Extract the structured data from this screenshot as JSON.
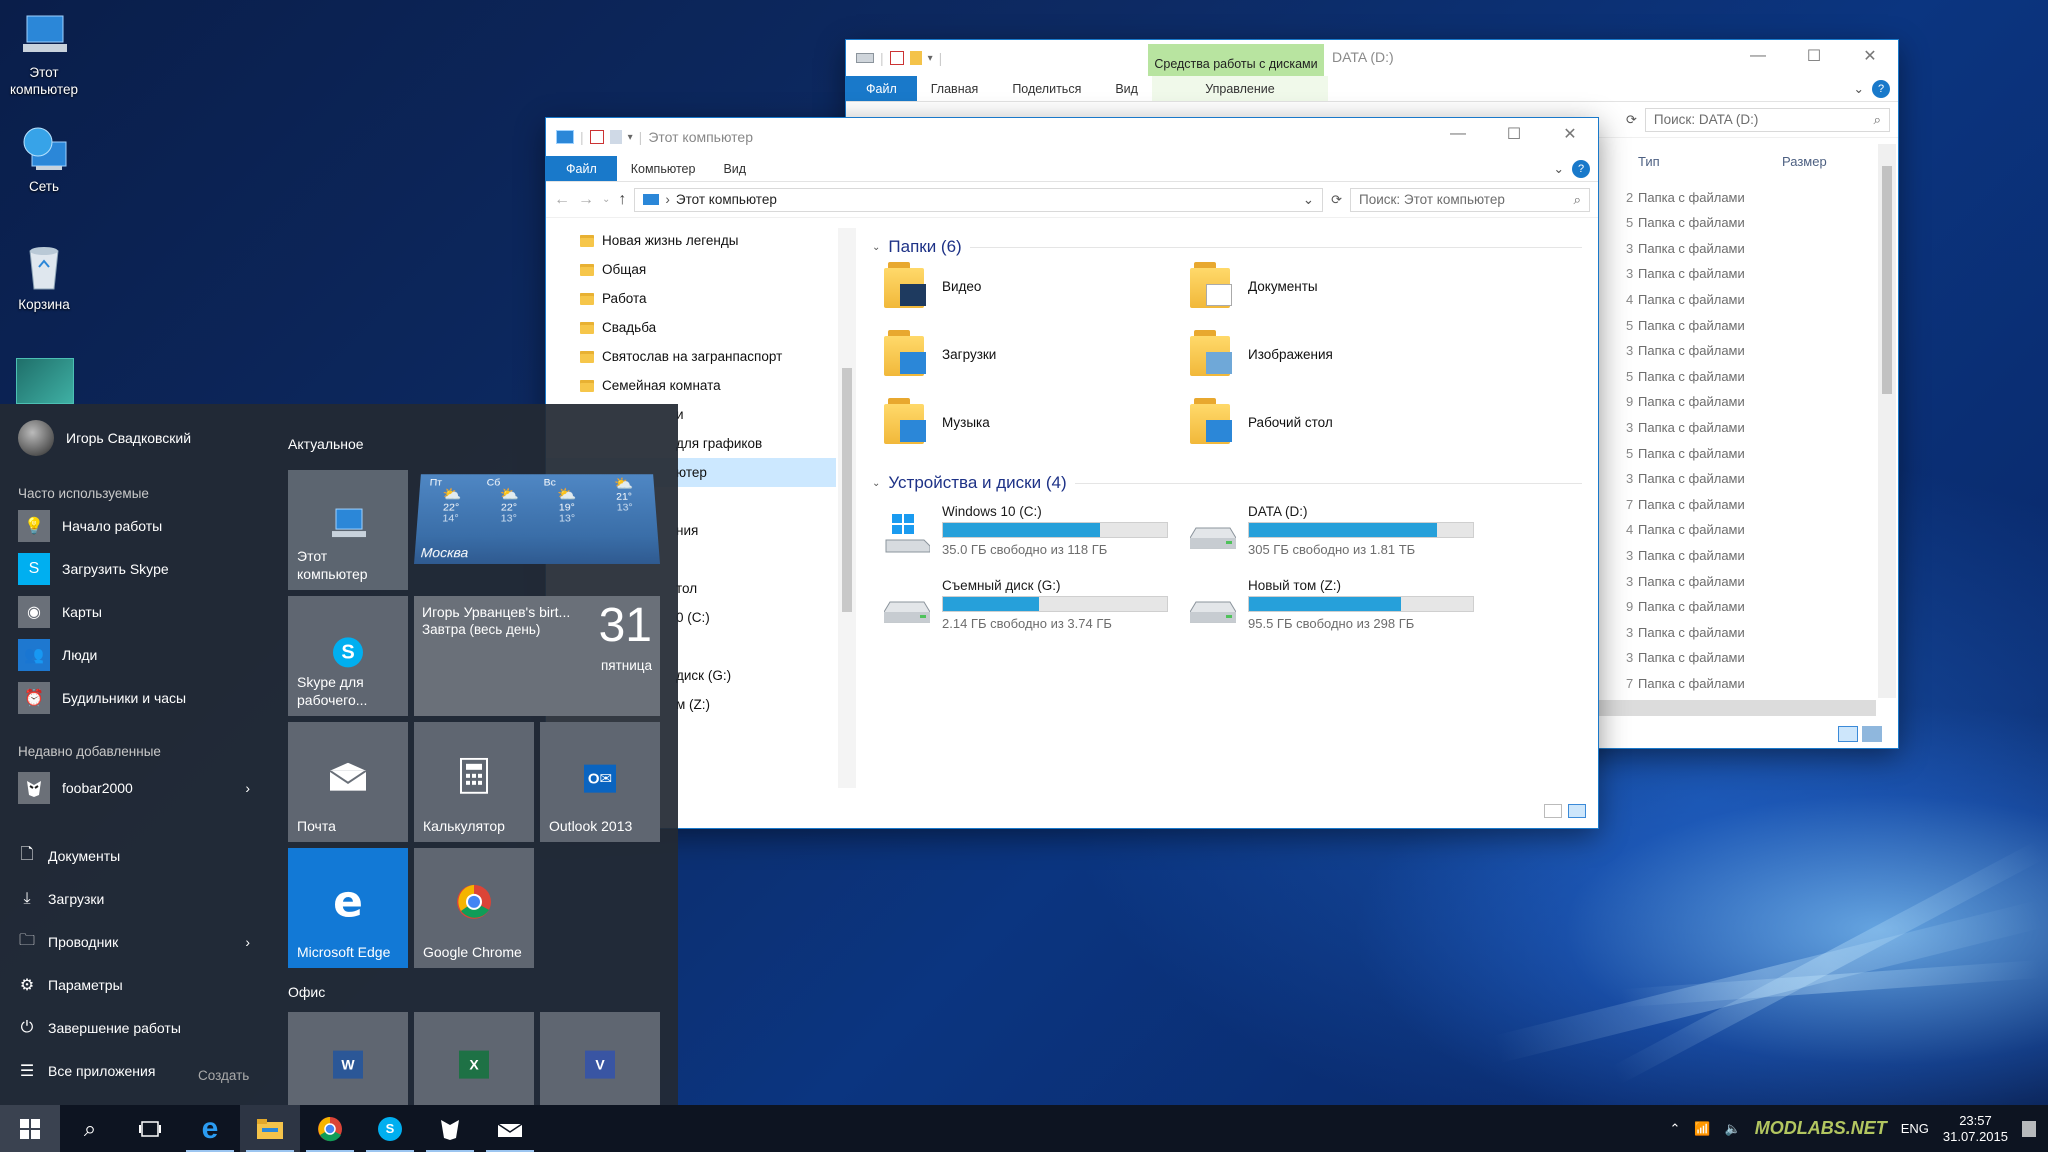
{
  "desktop": {
    "icons": [
      {
        "label": "Этот компьютер"
      },
      {
        "label": "Сеть"
      },
      {
        "label": "Корзина"
      }
    ]
  },
  "window_back": {
    "context_tab": "Средства работы с дисками",
    "title": "DATA (D:)",
    "ribbon": {
      "file": "Файл",
      "home": "Главная",
      "share": "Поделиться",
      "view": "Вид",
      "manage": "Управление"
    },
    "address": "DATA (D:)",
    "search_placeholder": "Поиск: DATA (D:)",
    "columns": {
      "type": "Тип",
      "size": "Размер"
    },
    "rows": [
      "Папка с файлами",
      "Папка с файлами",
      "Папка с файлами",
      "Папка с файлами",
      "Папка с файлами",
      "Папка с файлами",
      "Папка с файлами",
      "Папка с файлами",
      "Папка с файлами",
      "Папка с файлами",
      "Папка с файлами",
      "Папка с файлами",
      "Папка с файлами",
      "Папка с файлами",
      "Папка с файлами",
      "Папка с файлами",
      "Папка с файлами",
      "Папка с файлами",
      "Папка с файлами",
      "Папка с файлами"
    ],
    "row_prefixes": [
      "2",
      "5",
      "3",
      "3",
      "4",
      "5",
      "3",
      "5",
      "9",
      "3",
      "5",
      "3",
      "7",
      "4",
      "3",
      "3",
      "9",
      "3",
      "3",
      "7"
    ]
  },
  "window_front": {
    "title": "Этот компьютер",
    "ribbon": {
      "file": "Файл",
      "computer": "Компьютер",
      "view": "Вид"
    },
    "address": "Этот компьютер",
    "search_placeholder": "Поиск: Этот компьютер",
    "nav_items": [
      "Новая жизнь легенды",
      "Общая",
      "Работа",
      "Свадьба",
      "Святослав на загранпаспорт",
      "Семейная комната"
    ],
    "nav_partial": [
      "и",
      "для графиков",
      "ютер",
      "",
      "ния",
      "",
      "тол",
      "0 (C:)",
      "",
      "диск (G:)",
      "м (Z:)"
    ],
    "folders_header": "Папки (6)",
    "folders": [
      "Видео",
      "Документы",
      "Загрузки",
      "Изображения",
      "Музыка",
      "Рабочий стол"
    ],
    "drives_header": "Устройства и диски (4)",
    "drives": [
      {
        "name": "Windows 10 (C:)",
        "free": "35.0 ГБ свободно из 118 ГБ",
        "used_fraction": 0.7
      },
      {
        "name": "DATA (D:)",
        "free": "305 ГБ свободно из 1.81 ТБ",
        "used_fraction": 0.84
      },
      {
        "name": "Съемный диск (G:)",
        "free": "2.14 ГБ свободно из 3.74 ГБ",
        "used_fraction": 0.43
      },
      {
        "name": "Новый том (Z:)",
        "free": "95.5 ГБ свободно из 298 ГБ",
        "used_fraction": 0.68
      }
    ]
  },
  "start": {
    "user": "Игорь Свадковский",
    "frequent_header": "Часто используемые",
    "frequent": [
      "Начало работы",
      "Загрузить Skype",
      "Карты",
      "Люди",
      "Будильники и часы"
    ],
    "recent_header": "Недавно добавленные",
    "recent": [
      "foobar2000"
    ],
    "places": [
      "Документы",
      "Загрузки",
      "Проводник",
      "Параметры",
      "Завершение работы",
      "Все приложения"
    ],
    "create": "Создать",
    "group1": "Актуальное",
    "group2": "Офис",
    "tiles": {
      "this_pc": "Этот компьютер",
      "skype": "Skype для рабочего...",
      "calendar_event": "Игорь Урванцев's birt...",
      "calendar_when": "Завтра (весь день)",
      "calendar_day": "31",
      "calendar_weekday": "пятница",
      "mail": "Почта",
      "calc": "Калькулятор",
      "outlook": "Outlook 2013",
      "edge": "Microsoft Edge",
      "chrome": "Google Chrome"
    },
    "weather": {
      "city": "Москва",
      "days": [
        {
          "d": "Пт",
          "hi": "22°",
          "lo": "14°"
        },
        {
          "d": "Сб",
          "hi": "22°",
          "lo": "13°"
        },
        {
          "d": "Вс",
          "hi": "19°",
          "lo": "13°"
        },
        {
          "d": "",
          "hi": "21°",
          "lo": "13°"
        }
      ]
    }
  },
  "taskbar": {
    "lang": "ENG",
    "time": "23:57",
    "date": "31.07.2015",
    "watermark": "MODLABS.NET"
  }
}
